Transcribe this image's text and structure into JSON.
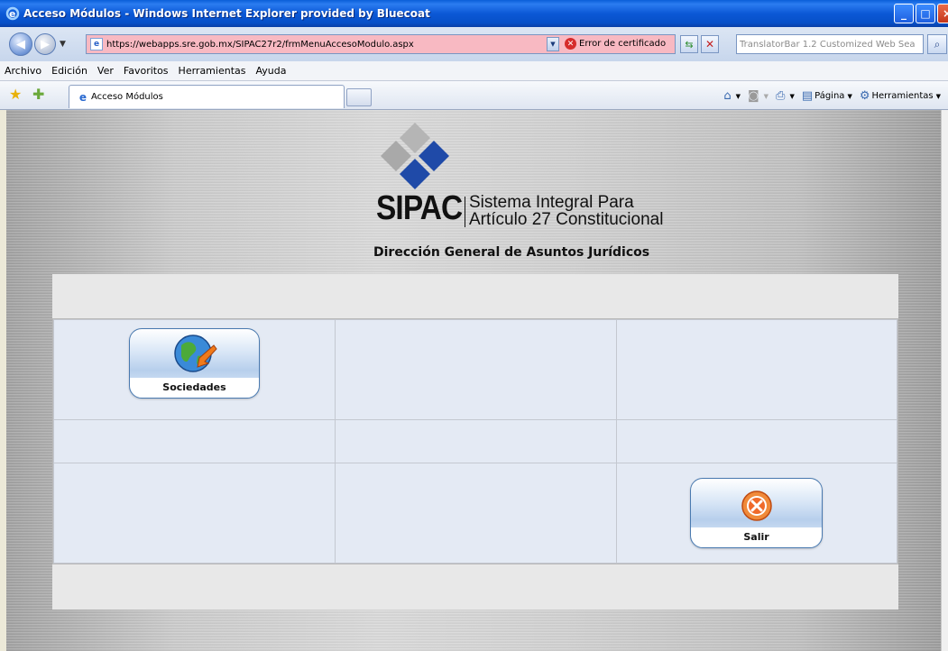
{
  "window": {
    "title": "Acceso Módulos - Windows Internet Explorer provided by Bluecoat",
    "controls": {
      "minimize": "_",
      "maximize": "□",
      "close": "×"
    }
  },
  "address_bar": {
    "url": "https://webapps.sre.gob.mx/SIPAC27r2/frmMenuAccesoModulo.aspx",
    "certificate_status": "Error de certificado",
    "search_placeholder": "TranslatorBar 1.2 Customized Web Sea"
  },
  "menu": {
    "items": [
      "Archivo",
      "Edición",
      "Ver",
      "Favoritos",
      "Herramientas",
      "Ayuda"
    ]
  },
  "tabs": {
    "active_label": "Acceso Módulos"
  },
  "command_bar": {
    "page_label": "Página",
    "tools_label": "Herramientas"
  },
  "page": {
    "logo_text": "SIPAC",
    "logo_line1": "Sistema Integral Para",
    "logo_line2": "Artículo 27 Constitucional",
    "department": "Dirección General de Asuntos Jurídicos",
    "modules": {
      "sociedades_label": "Sociedades",
      "salir_label": "Salir"
    }
  },
  "colors": {
    "url_bar_error": "#f8b9c2",
    "cell_bg": "#e4eaf4",
    "logo_blue": "#1f4aa8"
  },
  "icons": {
    "sociedades": "globe-arrow-icon",
    "salir": "close-circle-icon"
  }
}
